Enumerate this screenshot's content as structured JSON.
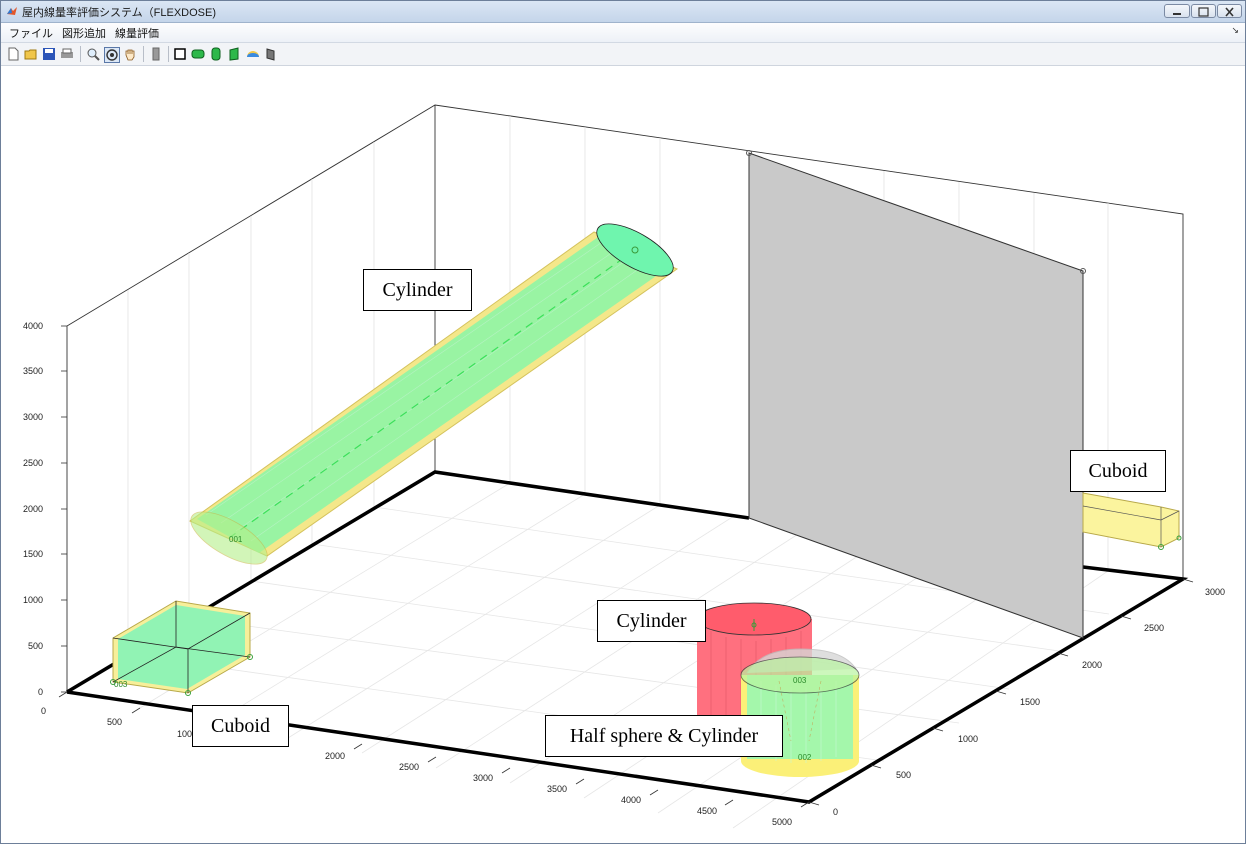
{
  "window": {
    "title": "屋内線量率評価システム（FLEXDOSE)"
  },
  "menu": {
    "file": "ファイル",
    "add_shape": "図形追加",
    "dose_eval": "線量評価"
  },
  "toolbar": {
    "icons": [
      "new-file-icon",
      "open-folder-icon",
      "save-icon",
      "print-icon",
      "zoom-icon",
      "rotate-3d-icon",
      "pan-hand-icon",
      "wall-icon",
      "cuboid-icon",
      "cylinder-icon",
      "cylinder-vertical-icon",
      "cylinder-cut-icon",
      "half-sphere-icon",
      "plate-icon"
    ]
  },
  "plot": {
    "z_ticks": [
      "0",
      "500",
      "1000",
      "1500",
      "2000",
      "2500",
      "3000",
      "3500",
      "4000"
    ],
    "x_ticks": [
      "0",
      "500",
      "1000",
      "2000",
      "2500",
      "3000",
      "3500",
      "4000",
      "4500",
      "5000"
    ],
    "y_ticks": [
      "0",
      "500",
      "1000",
      "1500",
      "2000",
      "2500",
      "3000"
    ],
    "object_ids": [
      "001",
      "002",
      "003"
    ]
  },
  "annotations": {
    "cylinder_top": "Cylinder",
    "cuboid_right": "Cuboid",
    "cylinder_mid": "Cylinder",
    "cuboid_left": "Cuboid",
    "half_sphere_cylinder": "Half sphere & Cylinder"
  },
  "colors": {
    "object_fill": "#7dffa0",
    "object_edge": "#f5e66a",
    "red_cylinder": "#ff6b7a",
    "wall": "#c9c9c9"
  }
}
